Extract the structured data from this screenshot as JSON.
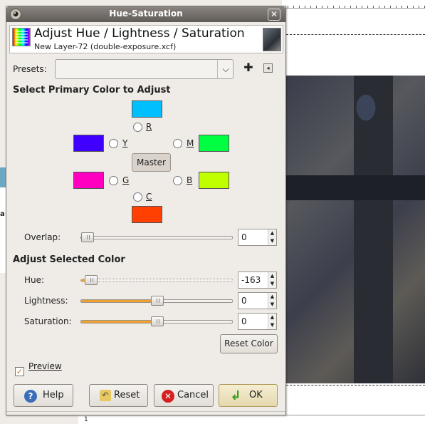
{
  "window": {
    "title": "Hue-Saturation",
    "close_symbol": "✕"
  },
  "header": {
    "title": "Adjust Hue / Lightness / Saturation",
    "subtitle": "New Layer-72 (double-exposure.xcf)"
  },
  "presets": {
    "label": "Presets:",
    "value": "",
    "arrow": "⌵",
    "add": "✚",
    "menu": "◂"
  },
  "primary": {
    "heading": "Select Primary Color to Adjust",
    "master_label": "Master",
    "r": "R",
    "y": "Y",
    "m": "M",
    "g": "G",
    "b": "B",
    "c": "C",
    "colors": {
      "r": "#00bfff",
      "y": "#4000ff",
      "m": "#00ff40",
      "g": "#ff00c0",
      "b": "#bfff00",
      "c": "#ff4000"
    }
  },
  "overlap": {
    "label": "Overlap:",
    "value": "0",
    "fraction": 0.0
  },
  "adjust": {
    "heading": "Adjust Selected Color",
    "hue": {
      "label": "Hue:",
      "value": "-163",
      "fraction": 0.0
    },
    "lightness": {
      "label": "Lightness:",
      "value": "0",
      "fraction": 0.5
    },
    "saturation": {
      "label": "Saturation:",
      "value": "0",
      "fraction": 0.5
    },
    "reset_color": "Reset Color"
  },
  "preview": {
    "label": "Preview",
    "checked": true
  },
  "buttons": {
    "help": "Help",
    "reset": "Reset",
    "cancel": "Cancel",
    "ok": "OK"
  },
  "background": {
    "ruler_label": "1",
    "left_label": "a"
  },
  "colors": {
    "accent": "#f0a030"
  }
}
